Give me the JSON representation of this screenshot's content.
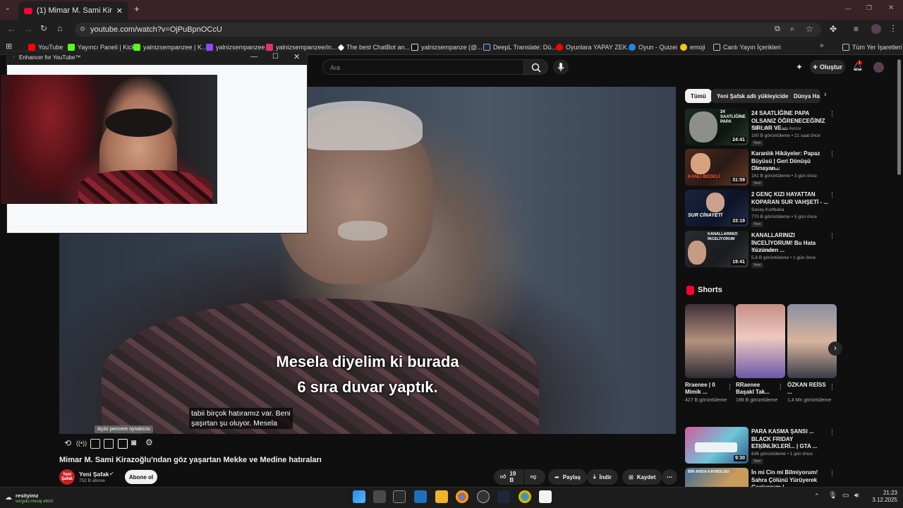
{
  "browser": {
    "tab_title": "(1) Mimar M. Sami Kirazoğlu'n",
    "url": "youtube.com/watch?v=OjPuBpnOCcU",
    "bookmarks": [
      {
        "label": "YouTube",
        "color": "#ff0000"
      },
      {
        "label": "Yayıncı Paneli | Kick",
        "color": "#53fc18"
      },
      {
        "label": "yalnizsempanzee | K...",
        "color": "#53fc18"
      },
      {
        "label": "yalnizsempanzee",
        "color": "#9146ff"
      },
      {
        "label": "yalnizsempanzee/in...",
        "color": "#e1306c"
      },
      {
        "label": "The best ChatBot an...",
        "color": "#ffffff"
      },
      {
        "label": "yalnizsempanze (@...",
        "color": "#ffffff"
      },
      {
        "label": "DeepL Translate: Dü...",
        "color": "#0f2b46"
      },
      {
        "label": "Oyunlara YAPAY ZEK...",
        "color": "#ff0000"
      },
      {
        "label": "Oyun - Quizei",
        "color": "#1e88e5"
      },
      {
        "label": "emoji",
        "color": "#f5c518"
      },
      {
        "label": "Canlı Yayın İçerikleri",
        "color": "#aaaaaa"
      }
    ],
    "all_bookmarks": "Tüm Yer İşaretleri"
  },
  "popup": {
    "title": "Enhancer for YouTube™"
  },
  "youtube": {
    "search_placeholder": "Ara",
    "create_label": "Oluştur",
    "notification_count": "1",
    "video": {
      "subtitle_line1": "Mesela diyelim ki burada",
      "subtitle_line2": "6 sıra duvar yaptık.",
      "caption_line1": "tabii birçok hatıramız var. Beni",
      "caption_line2": "şaşırtan şu oluyor. Mesela",
      "tooltip": "Açılır pencere oynatıcısı",
      "title": "Mimar M. Sami Kirazoğlu'ndan göz yaşartan Mekke ve Medine hatıraları"
    },
    "channel": {
      "avatar_text": "Yeni Şafak",
      "name": "Yeni Şafak",
      "subscribers": "752 B abone",
      "subscribe_label": "Abone ol"
    },
    "actions": {
      "likes": "19 B",
      "share": "Paylaş",
      "download": "İndir",
      "save": "Kaydet"
    },
    "chips": [
      "Tümü",
      "Yeni Şafak adlı yükleyiciden",
      "Dünya Ha"
    ],
    "recommendations": [
      {
        "title": "24 SAATLİĞİNE PAPA OLSANIZ ÖĞRENECEĞİNİZ SIRLAR VE ...",
        "channel": "TUNCER · Gizem Avcısı",
        "meta": "100 B görüntüleme • 21 saat önce",
        "badge": "Yeni",
        "duration": "24:41",
        "thumb_text": "24 SAATLİĞİNE PAPA"
      },
      {
        "title": "Karanlık Hikâyeler: Papaz Büyüsü | Geri Dönüşü Olmayan...",
        "channel": "Fonn Kriminal",
        "meta": "161 B görüntüleme • 3 gün önce",
        "badge": "Yeni",
        "duration": "31:59",
        "thumb_text": "KANLI BEDELİ"
      },
      {
        "title": "2 GENÇ KIZI HAYATTAN KOPARAN SUR VAHŞETİ - ...",
        "channel": "Savaş Kurtbaba",
        "meta": "770 B görüntüleme • 5 gün önce",
        "badge": "Yeni",
        "duration": "33:19",
        "thumb_text": "SUR CİNAYETİ"
      },
      {
        "title": "KANALLARINIZI İNCELİYORUM! Bu Hata Yüzünden ...",
        "channel": "Onur Güler",
        "meta": "5,8 B görüntüleme • 1 gün önce",
        "badge": "Yeni",
        "duration": "19:41",
        "thumb_text": "KANALLARINIZI İNCELİYORUM"
      },
      {
        "title": "PARA KASMA ŞANSI ... BLACK FRIDAY ETKİNLİKLERİ... | GTA ...",
        "channel": "Jaeger-X",
        "meta": "836 görüntüleme • 1 gün önce",
        "badge": "Yeni",
        "duration": "9:30",
        "thumb_text": ""
      },
      {
        "title": "İn mi Cin mi Bilmiyorum! Sahra Çölünü Yürüyerek Geçiyorum /...",
        "channel": "",
        "meta": "",
        "badge": "",
        "duration": "",
        "thumb_text": "BİR ANDA KAYBOLDU"
      }
    ],
    "shorts_header": "Shorts",
    "shorts": [
      {
        "title": "Rraenee | 0 Mimik ...",
        "views": "427 B görüntüleme"
      },
      {
        "title": "RRaenee Başakl Tak...",
        "views": "198 B görüntüleme"
      },
      {
        "title": "ÖZKAN REİSS ...",
        "views": "1,4 Mn görüntüleme"
      }
    ]
  },
  "taskbar": {
    "notification_user": "resityimz",
    "notification_text": "vurgulu mesaj etkinl",
    "time": "21:23",
    "date": "3.12.2025"
  }
}
